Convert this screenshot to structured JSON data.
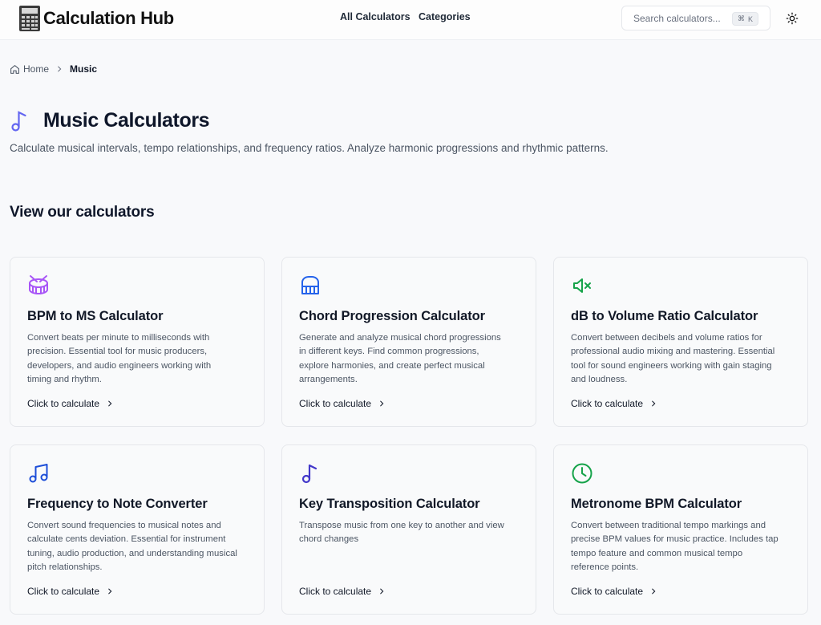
{
  "header": {
    "logo_text": "Calculation Hub",
    "nav": {
      "all": "All Calculators",
      "categories": "Categories"
    },
    "search": {
      "placeholder": "Search calculators...",
      "shortcut_symbol": "⌘",
      "shortcut_key": "K"
    }
  },
  "breadcrumb": {
    "home": "Home",
    "current": "Music"
  },
  "page": {
    "title": "Music Calculators",
    "subtitle": "Calculate musical intervals, tempo relationships, and frequency ratios. Analyze harmonic progressions and rhythmic patterns.",
    "section_title": "View our calculators"
  },
  "cards": [
    {
      "title": "BPM to MS Calculator",
      "description": "Convert beats per minute to milliseconds with precision. Essential tool for music producers, developers, and audio engineers working with timing and rhythm.",
      "cta": "Click to calculate",
      "icon": "drum-icon",
      "color": "#a855f7"
    },
    {
      "title": "Chord Progression Calculator",
      "description": "Generate and analyze musical chord progressions in different keys. Find common progressions, explore harmonies, and create perfect musical arrangements.",
      "cta": "Click to calculate",
      "icon": "piano-icon",
      "color": "#2563eb"
    },
    {
      "title": "dB to Volume Ratio Calculator",
      "description": "Convert between decibels and volume ratios for professional audio mixing and mastering. Essential tool for sound engineers working with gain staging and loudness.",
      "cta": "Click to calculate",
      "icon": "volume-mute-icon",
      "color": "#16a34a"
    },
    {
      "title": "Frequency to Note Converter",
      "description": "Convert sound frequencies to musical notes and calculate cents deviation. Essential for instrument tuning, audio production, and understanding musical pitch relationships.",
      "cta": "Click to calculate",
      "icon": "music-notes-icon",
      "color": "#1d4ed8"
    },
    {
      "title": "Key Transposition Calculator",
      "description": "Transpose music from one key to another and view chord changes",
      "cta": "Click to calculate",
      "icon": "music-note-icon",
      "color": "#4338ca"
    },
    {
      "title": "Metronome BPM Calculator",
      "description": "Convert between traditional tempo markings and precise BPM values for music practice. Includes tap tempo feature and common musical tempo reference points.",
      "cta": "Click to calculate",
      "icon": "clock-icon",
      "color": "#16a34a"
    }
  ],
  "colors": {
    "title_icon": "#6366f1"
  }
}
